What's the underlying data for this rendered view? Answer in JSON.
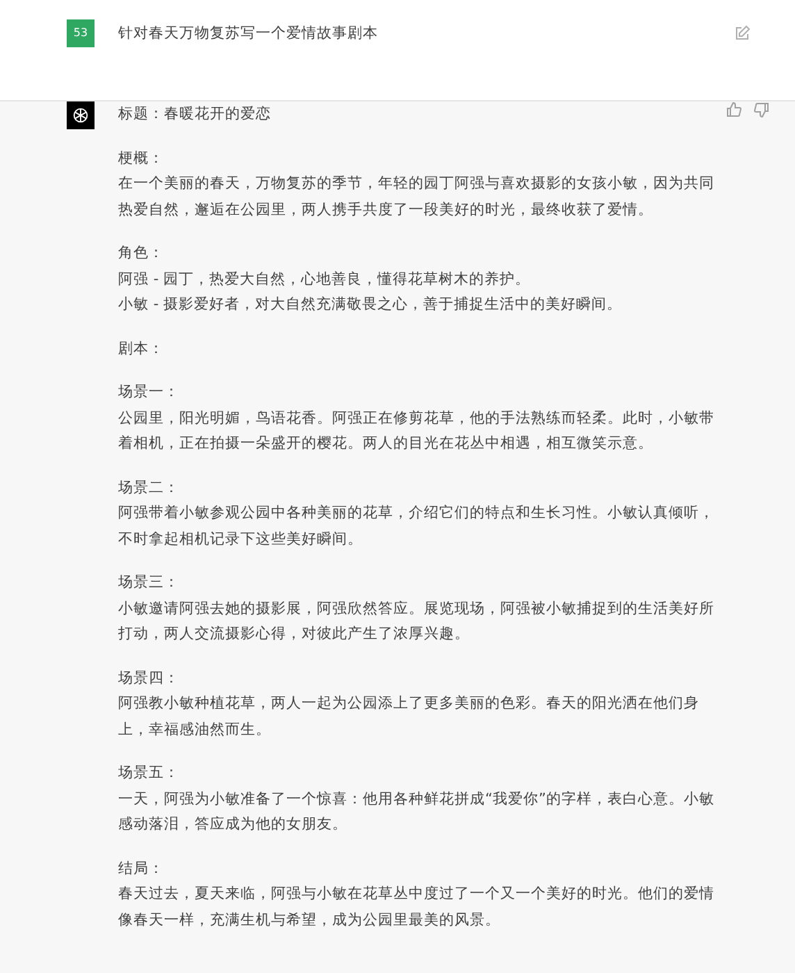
{
  "user_message": {
    "avatar": "53",
    "text": "针对春天万物复苏写一个爱情故事剧本"
  },
  "assistant_message": {
    "title": "标题：春暖花开的爱恋",
    "sections": [
      {
        "heading": "梗概：",
        "body": [
          "在一个美丽的春天，万物复苏的季节，年轻的园丁阿强与喜欢摄影的女孩小敏，因为共同热爱自然，邂逅在公园里，两人携手共度了一段美好的时光，最终收获了爱情。"
        ]
      },
      {
        "heading": "角色：",
        "body": [
          "阿强 - 园丁，热爱大自然，心地善良，懂得花草树木的养护。",
          "小敏 - 摄影爱好者，对大自然充满敬畏之心，善于捕捉生活中的美好瞬间。"
        ]
      },
      {
        "heading": "剧本："
      },
      {
        "heading": "场景一：",
        "body": [
          "公园里，阳光明媚，鸟语花香。阿强正在修剪花草，他的手法熟练而轻柔。此时，小敏带着相机，正在拍摄一朵盛开的樱花。两人的目光在花丛中相遇，相互微笑示意。"
        ]
      },
      {
        "heading": "场景二：",
        "body": [
          "阿强带着小敏参观公园中各种美丽的花草，介绍它们的特点和生长习性。小敏认真倾听，不时拿起相机记录下这些美好瞬间。"
        ]
      },
      {
        "heading": "场景三：",
        "body": [
          "小敏邀请阿强去她的摄影展，阿强欣然答应。展览现场，阿强被小敏捕捉到的生活美好所打动，两人交流摄影心得，对彼此产生了浓厚兴趣。"
        ]
      },
      {
        "heading": "场景四：",
        "body": [
          "阿强教小敏种植花草，两人一起为公园添上了更多美丽的色彩。春天的阳光洒在他们身上，幸福感油然而生。"
        ]
      },
      {
        "heading": "场景五：",
        "body": [
          "一天，阿强为小敏准备了一个惊喜：他用各种鲜花拼成“我爱你”的字样，表白心意。小敏感动落泪，答应成为他的女朋友。"
        ]
      },
      {
        "heading": "结局：",
        "body": [
          "春天过去，夏天来临，阿强与小敏在花草丛中度过了一个又一个美好的时光。他们的爱情像春天一样，充满生机与希望，成为公园里最美的风景。"
        ]
      }
    ]
  }
}
